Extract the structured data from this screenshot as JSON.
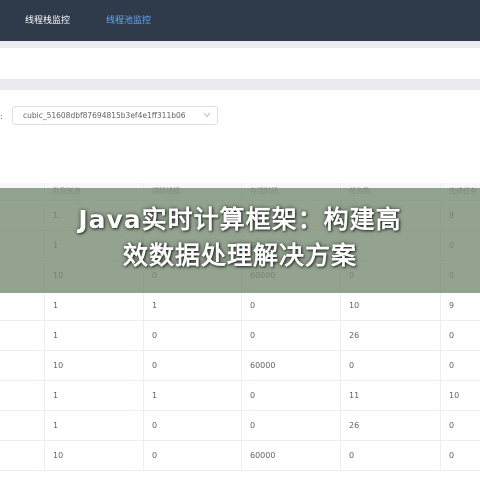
{
  "topnav": {
    "items": [
      {
        "label": "线程栈监控",
        "active": false
      },
      {
        "label": "线程池监控",
        "active": true
      }
    ]
  },
  "filter": {
    "label_tail": ":",
    "selected": "cubic_51608dbf87694815b3ef4e1ff311b06"
  },
  "table": {
    "columns": [
      "",
      "队列长度",
      "活跃线程",
      "存活时间",
      "任务数",
      "完成任务"
    ],
    "rows": [
      [
        "",
        "1",
        "1",
        "0",
        "",
        "8"
      ],
      [
        "",
        "1",
        "0",
        "0",
        "",
        "0"
      ],
      [
        "",
        "10",
        "0",
        "60000",
        "0",
        "0"
      ],
      [
        "",
        "1",
        "1",
        "0",
        "10",
        "9"
      ],
      [
        "",
        "1",
        "0",
        "0",
        "26",
        "0"
      ],
      [
        "",
        "10",
        "0",
        "60000",
        "0",
        "0"
      ],
      [
        "",
        "1",
        "1",
        "0",
        "11",
        "10"
      ],
      [
        "",
        "1",
        "0",
        "0",
        "26",
        "0"
      ],
      [
        "",
        "10",
        "0",
        "60000",
        "0",
        "0"
      ]
    ]
  },
  "banner": {
    "line1": "Java实时计算框架：构建高",
    "line2": "效数据处理解决方案"
  },
  "colors": {
    "nav_bg": "#2f3b4a",
    "nav_active": "#64a8ff",
    "banner_overlay": "#788c73"
  }
}
